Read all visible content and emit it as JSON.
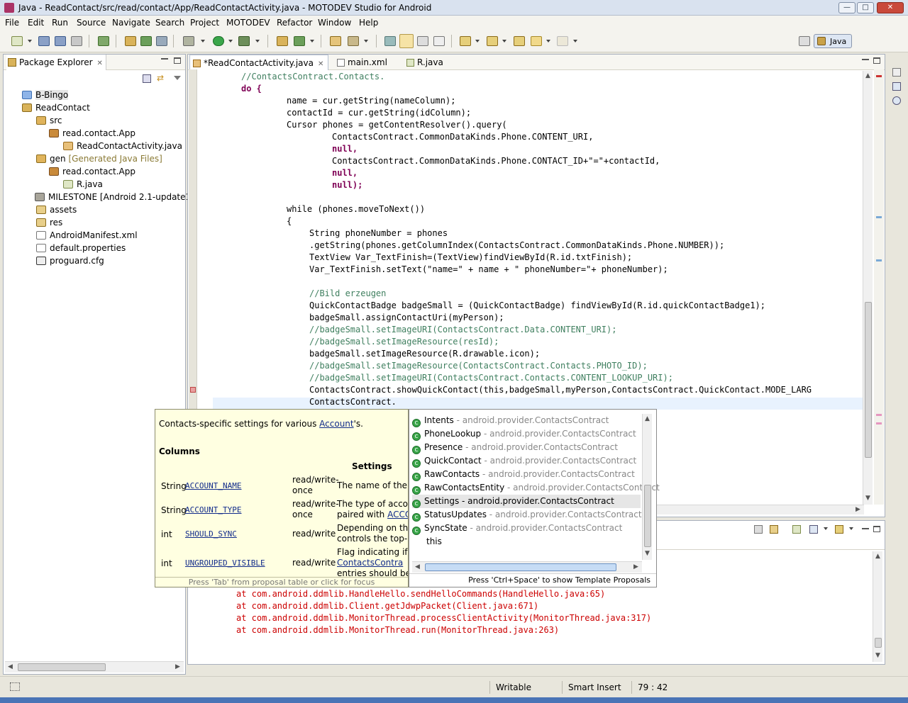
{
  "window": {
    "title": "Java - ReadContact/src/read/contact/App/ReadContactActivity.java - MOTODEV Studio for Android"
  },
  "menu": [
    "File",
    "Edit",
    "Run",
    "Source",
    "Navigate",
    "Search",
    "Project",
    "MOTODEV",
    "Refactor",
    "Window",
    "Help"
  ],
  "perspective": {
    "label": "Java"
  },
  "package_explorer": {
    "title": "Package Explorer",
    "items": [
      {
        "label": "B-Bingo"
      },
      {
        "label": "ReadContact"
      },
      {
        "label": "src"
      },
      {
        "label": "read.contact.App"
      },
      {
        "label": "ReadContactActivity.java"
      },
      {
        "label": "gen",
        "decoration": "[Generated Java Files]"
      },
      {
        "label": "read.contact.App"
      },
      {
        "label": "R.java"
      },
      {
        "label": "MILESTONE [Android 2.1-update1]"
      },
      {
        "label": "assets"
      },
      {
        "label": "res"
      },
      {
        "label": "AndroidManifest.xml"
      },
      {
        "label": "default.properties"
      },
      {
        "label": "proguard.cfg"
      }
    ]
  },
  "editor": {
    "tabs": [
      {
        "label": "*ReadContactActivity.java"
      },
      {
        "label": "main.xml"
      },
      {
        "label": "R.java"
      }
    ],
    "lines": [
      "//ContactsContract.Contacts.",
      "do {",
      "name = cur.getString(nameColumn);",
      "contactId = cur.getString(idColumn);",
      "Cursor phones = getContentResolver().query(",
      "ContactsContract.CommonDataKinds.Phone.CONTENT_URI,",
      "null,",
      "ContactsContract.CommonDataKinds.Phone.CONTACT_ID+\"=\"+contactId,",
      "null,",
      "null);",
      "while (phones.moveToNext())",
      "{",
      "String phoneNumber = phones",
      ".getString(phones.getColumnIndex(ContactsContract.CommonDataKinds.Phone.NUMBER));",
      "TextView Var_TextFinish=(TextView)findViewById(R.id.txtFinish);",
      "Var_TextFinish.setText(\"name=\" + name + \" phoneNumber=\"+ phoneNumber);",
      "//Bild erzeugen",
      "QuickContactBadge badgeSmall = (QuickContactBadge) findViewById(R.id.quickContactBadge1);",
      "badgeSmall.assignContactUri(myPerson);",
      "//badgeSmall.setImageURI(ContactsContract.Data.CONTENT_URI);",
      "//badgeSmall.setImageResource(resId);",
      "badgeSmall.setImageResource(R.drawable.icon);",
      "//badgeSmall.setImageResource(ContactsContract.Contacts.PHOTO_ID);",
      "//badgeSmall.setImageURI(ContactsContract.Contacts.CONTENT_LOOKUP_URI);",
      "ContactsContract.showQuickContact(this,badgeSmall,myPerson,ContactsContract.QuickContact.MODE_LARG",
      "ContactsContract."
    ]
  },
  "javadoc": {
    "description": "Contacts-specific settings for various",
    "description_link": "Account",
    "description_suffix": "'s.",
    "columns_heading": "Columns",
    "settings_heading": "Settings",
    "rows": [
      {
        "type": "String",
        "name": "ACCOUNT_NAME",
        "access": "read/write-once",
        "desc": "The name of the a"
      },
      {
        "type": "String",
        "name": "ACCOUNT_TYPE",
        "access": "read/write-once",
        "desc": "The type of accoun",
        "desc2": "paired with",
        "desc2_link": "ACCOU"
      },
      {
        "type": "int",
        "name": "SHOULD_SYNC",
        "access": "read/write",
        "desc": "Depending on the",
        "desc2": "controls the top-le"
      },
      {
        "type": "int",
        "name": "UNGROUPED_VISIBLE",
        "access": "read/write",
        "desc": "Flag indicating if c",
        "desc2_link": "ContactsContra",
        "desc3": "entries should be v"
      }
    ],
    "footer": "Press 'Tab' from proposal table or click for focus"
  },
  "proposals": {
    "items": [
      {
        "name": "Intents",
        "pkg": " - android.provider.ContactsContract",
        "selected": false
      },
      {
        "name": "PhoneLookup",
        "pkg": " - android.provider.ContactsContract",
        "selected": false
      },
      {
        "name": "Presence",
        "pkg": " - android.provider.ContactsContract",
        "selected": false
      },
      {
        "name": "QuickContact",
        "pkg": " - android.provider.ContactsContract",
        "selected": false
      },
      {
        "name": "RawContacts",
        "pkg": " - android.provider.ContactsContract",
        "selected": false
      },
      {
        "name": "RawContactsEntity",
        "pkg": " - android.provider.ContactsContract",
        "selected": false
      },
      {
        "name": "Settings",
        "pkg": " - android.provider.ContactsContract",
        "selected": true
      },
      {
        "name": "StatusUpdates",
        "pkg": " - android.provider.ContactsContract",
        "selected": false
      },
      {
        "name": "SyncState",
        "pkg": " - android.provider.ContactsContract",
        "selected": false
      },
      {
        "name": "this",
        "pkg": "",
        "selected": false
      }
    ],
    "footer": "Press 'Ctrl+Space' to show Template Proposals"
  },
  "console": {
    "lines": [
      "at com.android.ddmlib.HandleHello.sendHelloCommands(HandleHello.java:65)",
      "at com.android.ddmlib.Client.getJdwpPacket(Client.java:671)",
      "at com.android.ddmlib.MonitorThread.processClientActivity(MonitorThread.java:317)",
      "at com.android.ddmlib.MonitorThread.run(MonitorThread.java:263)"
    ]
  },
  "status": {
    "writable": "Writable",
    "insert_mode": "Smart Insert",
    "position": "79 : 42"
  },
  "colors": {
    "keyword": "#7f0055",
    "comment": "#3f7f5f",
    "string": "#2a00ff",
    "error": "#cc0000",
    "selection": "#e8f2fe"
  }
}
